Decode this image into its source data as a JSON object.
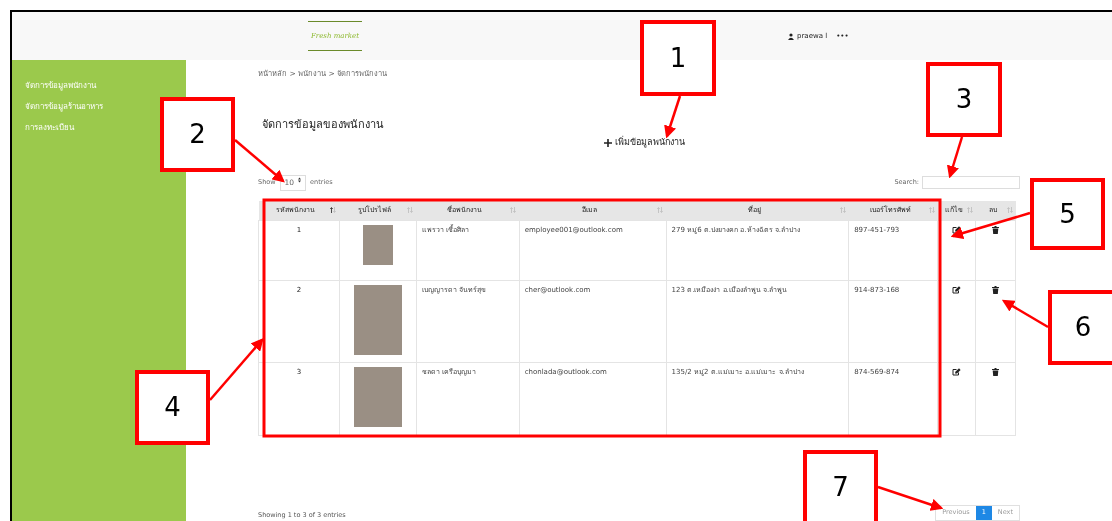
{
  "header": {
    "logo": "Fresh market",
    "user": "praewa l",
    "more": "•••"
  },
  "sidebar": {
    "items": [
      {
        "label": "จัดการข้อมูลพนักงาน"
      },
      {
        "label": "จัดการข้อมูลร้านอาหาร"
      },
      {
        "label": "การลงทะเบียน"
      }
    ]
  },
  "breadcrumb": "หน้าหลัก > พนักงาน > จัดการพนักงาน",
  "page_title": "จัดการข้อมูลของพนักงาน",
  "add_button": {
    "label": "เพิ่มข้อมูลพนักงาน"
  },
  "length": {
    "show": "Show",
    "value": "10",
    "entries": "entries"
  },
  "search": {
    "label": "Search:"
  },
  "table": {
    "columns": [
      {
        "label": "รหัสพนักงาน",
        "sorted": true
      },
      {
        "label": "รูปโปรไฟล์",
        "sorted": false
      },
      {
        "label": "ชื่อพนักงาน",
        "sorted": false
      },
      {
        "label": "อีเมล",
        "sorted": false
      },
      {
        "label": "ที่อยู่",
        "sorted": false
      },
      {
        "label": "เบอร์โทรศัพท์",
        "sorted": false
      },
      {
        "label": "แก้ไข",
        "sorted": false
      },
      {
        "label": "ลบ",
        "sorted": false
      }
    ],
    "rows": [
      {
        "id": "1",
        "name": "แพรวา เชื้อศิลา",
        "email": "employee001@outlook.com",
        "address": "279 หมู่6 ต.ปงยางคก อ.ห้างฉัตร จ.ลำปาง",
        "phone": "897-451-793"
      },
      {
        "id": "2",
        "name": "เบญญารดา จันทร์สุข",
        "email": "cher@outlook.com",
        "address": "123 ต.เหมืองง่า อ.เมืองลำพูน จ.ลำพูน",
        "phone": "914-873-168"
      },
      {
        "id": "3",
        "name": "ชลดา เครือบุญมา",
        "email": "chonlada@outlook.com",
        "address": "135/2 หมู่2 ต.แม่เมาะ อ.แม่เมาะ จ.ลำปาง",
        "phone": "874-569-874"
      }
    ]
  },
  "info": "Showing 1 to 3 of 3 entries",
  "pagination": [
    {
      "label": "Previous",
      "selected": false
    },
    {
      "label": "1",
      "selected": true
    },
    {
      "label": "Next",
      "selected": false
    }
  ],
  "callouts": [
    {
      "number": "1"
    },
    {
      "number": "2"
    },
    {
      "number": "3"
    },
    {
      "number": "4"
    },
    {
      "number": "5"
    },
    {
      "number": "6"
    },
    {
      "number": "7"
    }
  ]
}
